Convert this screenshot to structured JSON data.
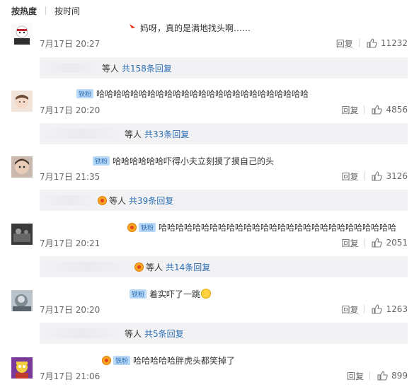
{
  "sort": {
    "hot": "按热度",
    "time": "按时间"
  },
  "comments": [
    {
      "text": "妈呀，真的是满地找头啊……",
      "date": "7月17日 20:27",
      "reply": "回复",
      "likes": "11232",
      "sub_prefix": "等人",
      "sub_count": "共158条回复"
    },
    {
      "badge": "铁粉",
      "text": "哈哈哈哈哈哈哈哈哈哈哈哈哈哈哈哈哈哈哈哈哈哈哈哈哈",
      "date": "7月17日 20:20",
      "reply": "回复",
      "likes": "4856",
      "sub_prefix": "等人",
      "sub_count": "共33条回复"
    },
    {
      "badge": "铁粉",
      "text": "哈哈哈哈哈哈吓得小夫立刻摸了摸自己的头",
      "date": "7月17日 21:35",
      "reply": "回复",
      "likes": "3126",
      "sub_prefix": "等人",
      "sub_count": "共39条回复"
    },
    {
      "badge": "铁粉",
      "text": "哈哈哈哈哈哈哈哈哈哈哈哈哈哈哈哈哈哈哈哈哈哈哈哈哈哈哈哈",
      "date": "7月17日 20:21",
      "reply": "回复",
      "likes": "2051",
      "sub_prefix": "等人",
      "sub_count": "共14条回复"
    },
    {
      "badge": "铁粉",
      "text": "着实吓了一跳",
      "date": "7月17日 20:20",
      "reply": "回复",
      "likes": "1263",
      "sub_prefix": "等人",
      "sub_count": "共5条回复"
    },
    {
      "badge": "铁粉",
      "text": "哈哈哈哈哈胖虎头都笑掉了",
      "date": "7月17日 21:06",
      "reply": "回复",
      "likes": "899"
    }
  ]
}
